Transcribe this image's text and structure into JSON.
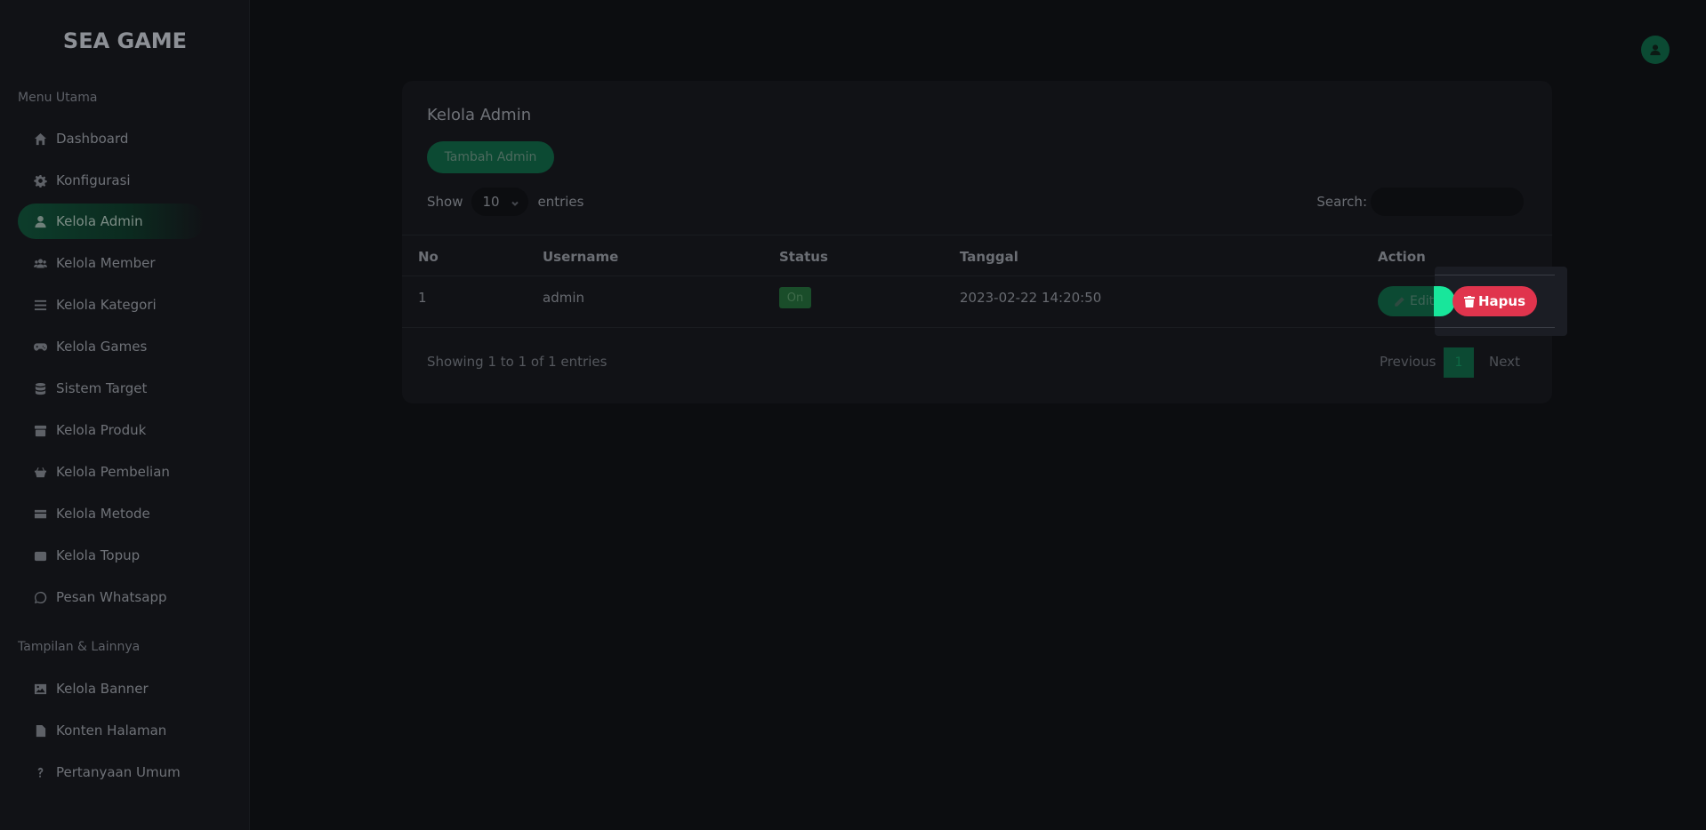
{
  "brand": {
    "logo_text": "SEA GAME"
  },
  "sidebar": {
    "section_main": "Menu Utama",
    "section_other": "Tampilan & Lainnya",
    "items": [
      {
        "label": "Dashboard",
        "icon": "home-icon"
      },
      {
        "label": "Konfigurasi",
        "icon": "gear-icon"
      },
      {
        "label": "Kelola Admin",
        "icon": "user-icon",
        "active": true
      },
      {
        "label": "Kelola Member",
        "icon": "users-icon"
      },
      {
        "label": "Kelola Kategori",
        "icon": "list-icon"
      },
      {
        "label": "Kelola Games",
        "icon": "gamepad-icon"
      },
      {
        "label": "Sistem Target",
        "icon": "database-icon"
      },
      {
        "label": "Kelola Produk",
        "icon": "box-icon"
      },
      {
        "label": "Kelola Pembelian",
        "icon": "basket-icon"
      },
      {
        "label": "Kelola Metode",
        "icon": "credit-card-icon"
      },
      {
        "label": "Kelola Topup",
        "icon": "wallet-icon"
      },
      {
        "label": "Pesan Whatsapp",
        "icon": "whatsapp-icon"
      }
    ],
    "other_items": [
      {
        "label": "Kelola Banner",
        "icon": "image-icon"
      },
      {
        "label": "Konten Halaman",
        "icon": "file-icon"
      },
      {
        "label": "Pertanyaan Umum",
        "icon": "question-icon"
      }
    ]
  },
  "header": {
    "avatar_icon": "user-circle-icon"
  },
  "card": {
    "title": "Kelola Admin",
    "add_button": "Tambah Admin",
    "show_label": "Show",
    "page_length": "10",
    "entries_label": "entries",
    "search_label": "Search:",
    "search_value": "",
    "columns": [
      "No",
      "Username",
      "Status",
      "Tanggal",
      "Action"
    ],
    "rows": [
      {
        "no": "1",
        "username": "admin",
        "status": "On",
        "tanggal": "2023-02-22 14:20:50",
        "edit_label": "Edit",
        "delete_label": "Hapus"
      }
    ],
    "info": "Showing 1 to 1 of 1 entries",
    "pagination": {
      "previous": "Previous",
      "current": "1",
      "next": "Next"
    }
  },
  "colors": {
    "accent": "#0c4a33",
    "accent_bright": "#18e69b",
    "danger": "#e0344d",
    "background": "#0c0d10",
    "panel": "#111216"
  }
}
